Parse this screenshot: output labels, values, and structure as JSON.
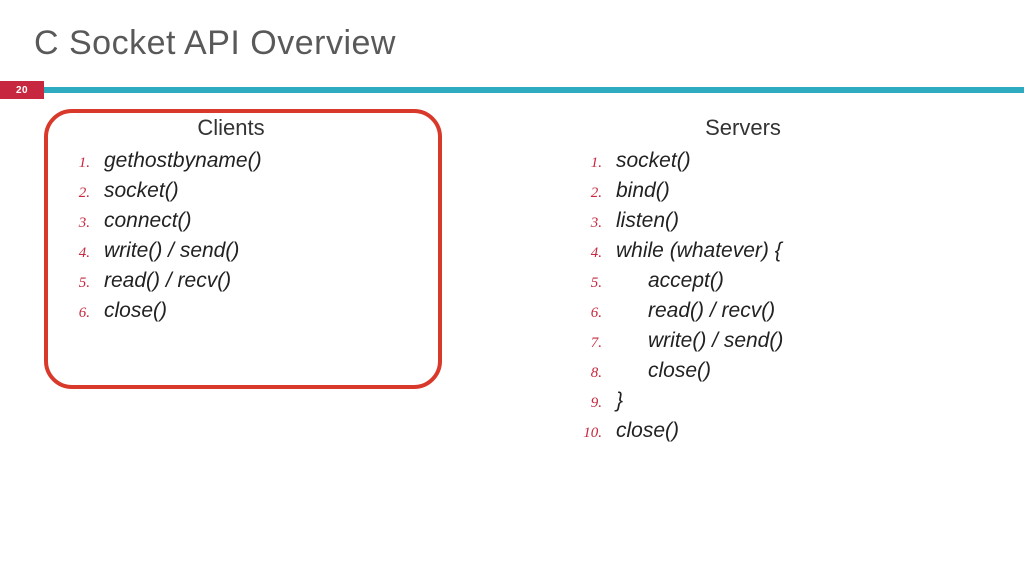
{
  "page_number": "20",
  "title": "C Socket API Overview",
  "accent_teal": "#2eabc1",
  "accent_red": "#c8283f",
  "left": {
    "heading": "Clients",
    "highlighted": true,
    "items": [
      {
        "n": "1.",
        "text": "gethostbyname()",
        "indent": false
      },
      {
        "n": "2.",
        "text": "socket()",
        "indent": false
      },
      {
        "n": "3.",
        "text": "connect()",
        "indent": false
      },
      {
        "n": "4.",
        "text": "write() / send()",
        "indent": false
      },
      {
        "n": "5.",
        "text": "read() / recv()",
        "indent": false
      },
      {
        "n": "6.",
        "text": "close()",
        "indent": false
      }
    ]
  },
  "right": {
    "heading": "Servers",
    "highlighted": false,
    "items": [
      {
        "n": "1.",
        "text": "socket()",
        "indent": false
      },
      {
        "n": "2.",
        "text": "bind()",
        "indent": false
      },
      {
        "n": "3.",
        "text": "listen()",
        "indent": false
      },
      {
        "n": "4.",
        "text": "while (whatever) {",
        "indent": false
      },
      {
        "n": "5.",
        "text": "accept()",
        "indent": true
      },
      {
        "n": "6.",
        "text": "read() / recv()",
        "indent": true
      },
      {
        "n": "7.",
        "text": "write() / send()",
        "indent": true
      },
      {
        "n": "8.",
        "text": "close()",
        "indent": true
      },
      {
        "n": "9.",
        "text": "}",
        "indent": false
      },
      {
        "n": "10.",
        "text": "close()",
        "indent": false
      }
    ]
  }
}
